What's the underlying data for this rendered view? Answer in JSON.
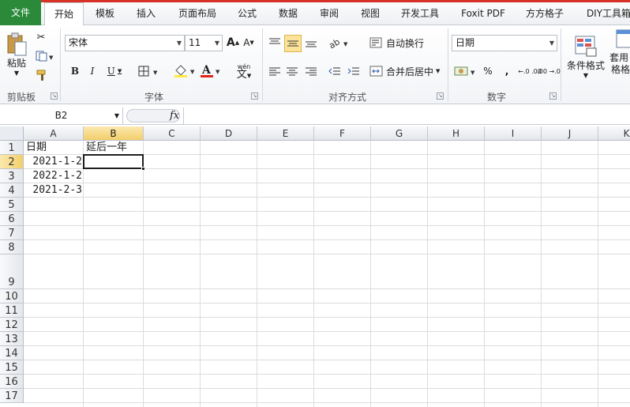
{
  "tabs": [
    "文件",
    "开始",
    "模板",
    "插入",
    "页面布局",
    "公式",
    "数据",
    "审阅",
    "视图",
    "开发工具",
    "Foxit PDF",
    "方方格子",
    "DIY工具箱"
  ],
  "active_tab": "开始",
  "clipboard": {
    "paste": "粘贴",
    "group": "剪贴板"
  },
  "font": {
    "name": "宋体",
    "size": "11",
    "group": "字体",
    "bold": "B",
    "italic": "I",
    "underline": "U",
    "grow": "A",
    "shrink": "A",
    "phonetic": "wén 文",
    "font_color": "A"
  },
  "alignment": {
    "wrap": "自动换行",
    "merge": "合并后居中",
    "group": "对齐方式"
  },
  "number": {
    "format": "日期",
    "percent": "%",
    "comma": ",",
    "inc": "←.0 .00",
    "dec": ".00 →.0",
    "group": "数字"
  },
  "styles": {
    "conditional": "条件格式",
    "table": "套用 表格格式"
  },
  "name_box": "B2",
  "fx": "fx",
  "formula_value": "",
  "columns": [
    "A",
    "B",
    "C",
    "D",
    "E",
    "F",
    "G",
    "H",
    "I",
    "J",
    "K"
  ],
  "rows": [
    "1",
    "2",
    "3",
    "4",
    "5",
    "6",
    "7",
    "8",
    "9",
    "10",
    "11",
    "12",
    "13",
    "14",
    "15",
    "16",
    "17"
  ],
  "cells": {
    "A1": "日期",
    "B1": "延后一年",
    "A2": "2021-1-2",
    "A3": "2022-1-2",
    "A4": "2021-2-3"
  },
  "selected_cell": "B2",
  "colors": {
    "file_tab": "#2a8a3a",
    "accent_red": "#d63228",
    "selection_header": "#f3cf6a"
  }
}
